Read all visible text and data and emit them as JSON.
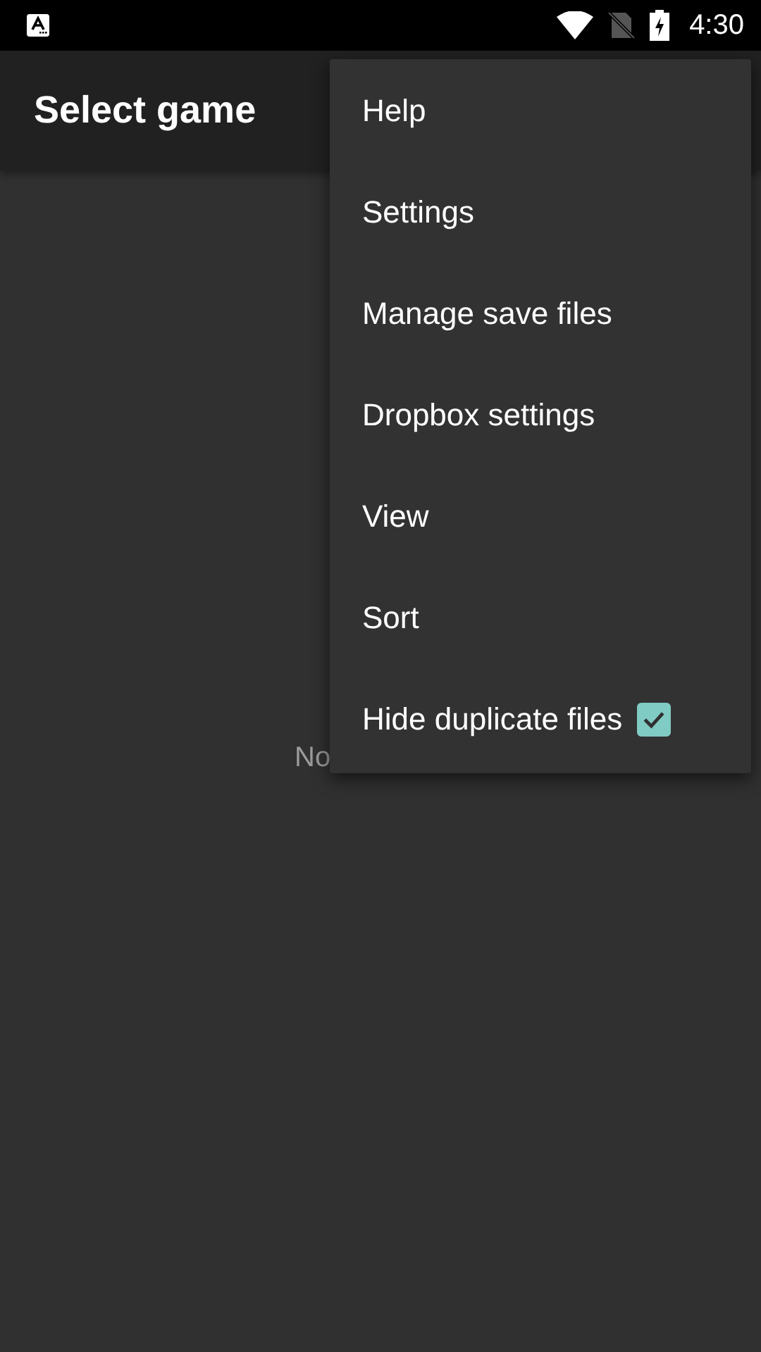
{
  "status_bar": {
    "time": "4:30"
  },
  "app_bar": {
    "title": "Select game"
  },
  "empty_message": "No",
  "menu": [
    {
      "kind": "plain",
      "label": "Help"
    },
    {
      "kind": "plain",
      "label": "Settings"
    },
    {
      "kind": "plain",
      "label": "Manage save files"
    },
    {
      "kind": "plain",
      "label": "Dropbox settings"
    },
    {
      "kind": "plain",
      "label": "View"
    },
    {
      "kind": "plain",
      "label": "Sort"
    },
    {
      "kind": "checkbox",
      "label": "Hide duplicate files",
      "checked": true
    }
  ]
}
